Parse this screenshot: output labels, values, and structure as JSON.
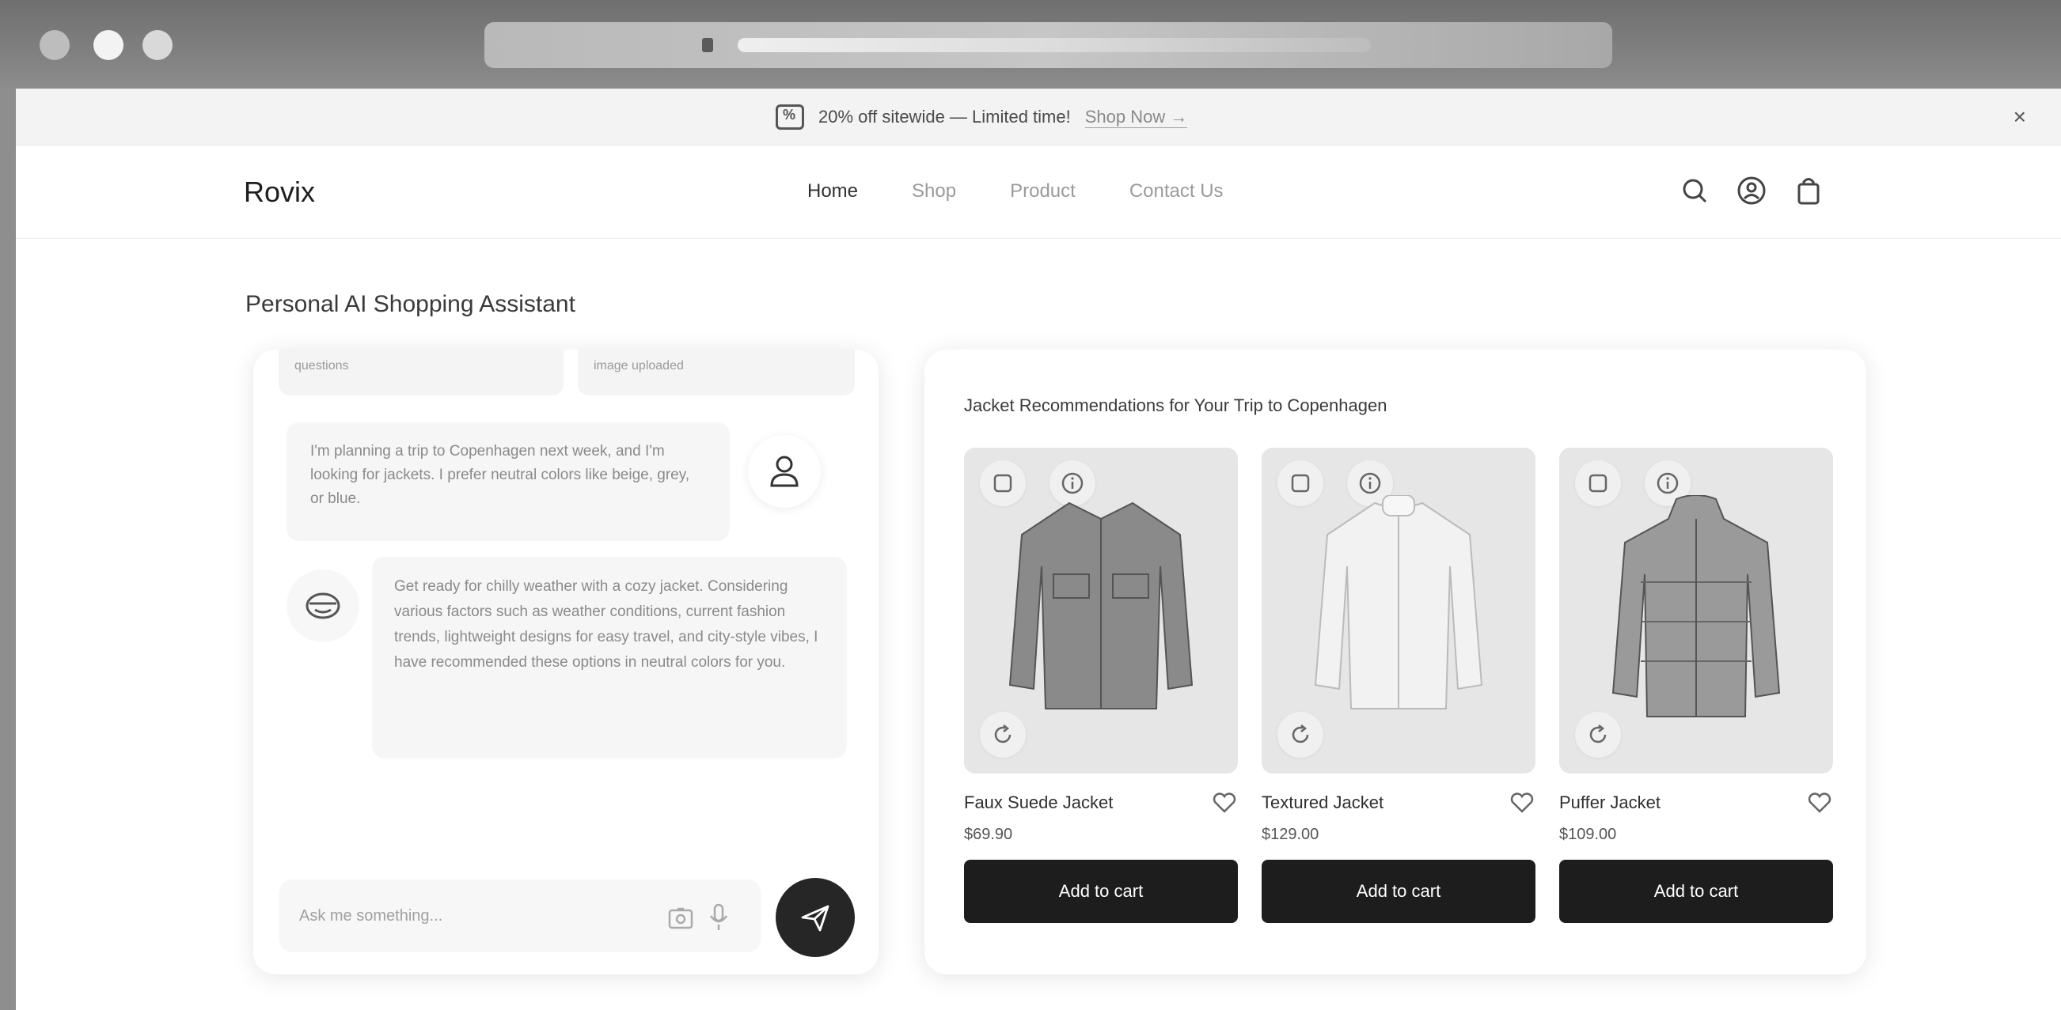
{
  "promo": {
    "text": "20% off sitewide — Limited time!",
    "link": "Shop Now →",
    "close": "×"
  },
  "nav": {
    "logo": "Rovix",
    "links": [
      "Home",
      "Shop",
      "Product",
      "Contact Us"
    ]
  },
  "page": {
    "title": "Personal AI Shopping Assistant"
  },
  "chat": {
    "chips": [
      "questions",
      "image uploaded"
    ],
    "user_message": "I'm planning a trip to Copenhagen next week, and I'm looking for jackets. I prefer neutral colors like beige, grey, or blue.",
    "bot_message": "Get ready for chilly weather with a cozy jacket. Considering various factors such as weather conditions, current fashion trends, lightweight designs for easy travel, and city-style vibes, I have recommended these options in neutral colors for you.",
    "input_placeholder": "Ask me something..."
  },
  "recommendations": {
    "title": "Jacket Recommendations for Your Trip to Copenhagen",
    "products": [
      {
        "name": "Faux Suede Jacket",
        "price": "$69.90",
        "button": "Add to cart",
        "color": "#8a8a8a"
      },
      {
        "name": "Textured Jacket",
        "price": "$129.00",
        "button": "Add to cart",
        "color": "#f2f2f2"
      },
      {
        "name": "Puffer Jacket",
        "price": "$109.00",
        "button": "Add to cart",
        "color": "#9a9a9a"
      }
    ]
  },
  "colors": {
    "accent": "#1d1d1d",
    "background": "#ffffff",
    "promo_bar": "#f3f3f3"
  }
}
